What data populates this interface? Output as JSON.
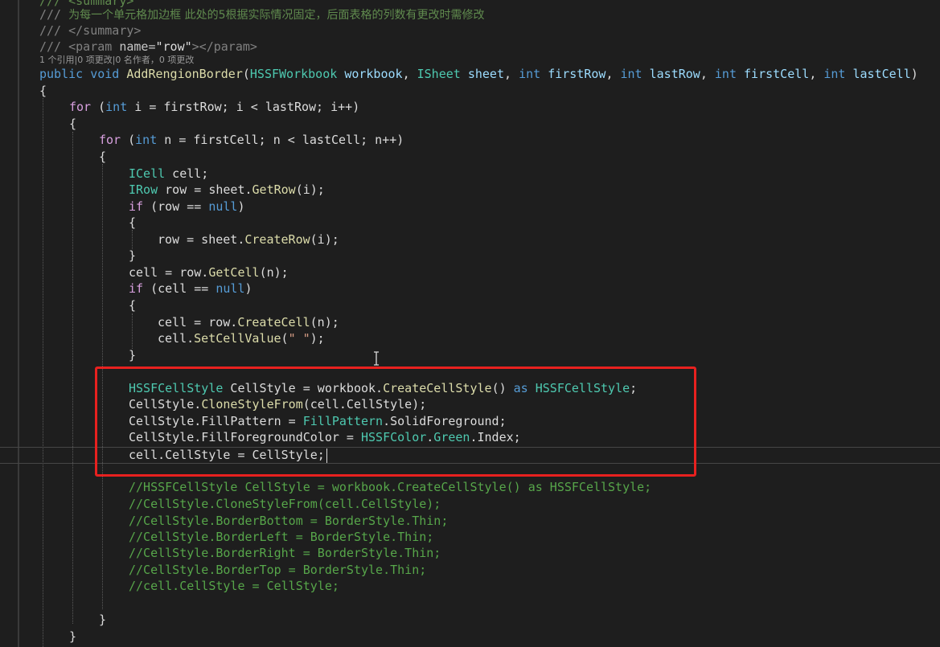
{
  "editor": {
    "theme": "dark",
    "accent_colors": {
      "comment": "#57a64a",
      "keyword": "#569cd6",
      "control": "#d8a0df",
      "type": "#4ec9b0",
      "method": "#dcdcaa",
      "highlight_box": "#e8211f"
    }
  },
  "code": {
    "l0": "/// <summary>",
    "l1_prefix": "/// ",
    "l1_text": "为每一个单元格加边框 此处的5根据实际情况固定，后面表格的列数有更改时需修改",
    "l2_prefix": "/// ",
    "l2_tag": "</summary>",
    "l3_prefix": "/// ",
    "l3_tag_open": "<param ",
    "l3_attr": "name=",
    "l3_val": "\"row\"",
    "l3_tag_close": "></param>",
    "codelens": "1 个引用|0 项更改|0 名作者，0 项更改",
    "sig": {
      "public": "public",
      "void": "void",
      "name": "AddRengionBorder",
      "p1type": "HSSFWorkbook",
      "p1": "workbook",
      "p2type": "ISheet",
      "p2": "sheet",
      "int1": "int",
      "p3": "firstRow",
      "int2": "int",
      "p4": "lastRow",
      "int3": "int",
      "p5": "firstCell",
      "int4": "int",
      "p6": "lastCell"
    },
    "open_brace": "{",
    "close_brace": "}",
    "for1_kw": "for",
    "for1_rest_a": " (",
    "for1_int": "int",
    "for1_rest_b": " i = firstRow; i < lastRow; i++)",
    "for2_kw": "for",
    "for2_rest_a": " (",
    "for2_int": "int",
    "for2_rest_b": " n = firstCell; n < lastCell; n++)",
    "icell_type": "ICell",
    "icell_rest": " cell;",
    "irow_type": "IRow",
    "irow_rest_a": " row = sheet.",
    "irow_method": "GetRow",
    "irow_rest_b": "(i);",
    "if1_kw": "if",
    "if1_rest_a": " (row == ",
    "if1_null": "null",
    "if1_rest_b": ")",
    "createrow_a": "row = sheet.",
    "createrow_method": "CreateRow",
    "createrow_b": "(i);",
    "getcell_a": "cell = row.",
    "getcell_method": "GetCell",
    "getcell_b": "(n);",
    "if2_kw": "if",
    "if2_rest_a": " (cell == ",
    "if2_null": "null",
    "if2_rest_b": ")",
    "createcell_a": "cell = row.",
    "createcell_method": "CreateCell",
    "createcell_b": "(n);",
    "setvalue_a": "cell.",
    "setvalue_method": "SetCellValue",
    "setvalue_b": "(",
    "setvalue_str": "\" \"",
    "setvalue_c": ");",
    "h1_type": "HSSFCellStyle",
    "h1_rest_a": " CellStyle = workbook.",
    "h1_method": "CreateCellStyle",
    "h1_rest_b": "() ",
    "h1_as": "as",
    "h1_rest_c": " ",
    "h1_type2": "HSSFCellStyle",
    "h1_semi": ";",
    "h2_a": "CellStyle.",
    "h2_method": "CloneStyleFrom",
    "h2_b": "(cell.CellStyle);",
    "h3_a": "CellStyle.FillPattern = ",
    "h3_type": "FillPattern",
    "h3_b": ".SolidForeground;",
    "h4_a": "CellStyle.FillForegroundColor = ",
    "h4_type": "HSSFColor",
    "h4_dot": ".",
    "h4_type2": "Green",
    "h4_b": ".Index;",
    "h5": "cell.CellStyle = CellStyle;",
    "c1": "//HSSFCellStyle CellStyle = workbook.CreateCellStyle() as HSSFCellStyle;",
    "c2": "//CellStyle.CloneStyleFrom(cell.CellStyle);",
    "c3": "//CellStyle.BorderBottom = BorderStyle.Thin;",
    "c4": "//CellStyle.BorderLeft = BorderStyle.Thin;",
    "c5": "//CellStyle.BorderRight = BorderStyle.Thin;",
    "c6": "//CellStyle.BorderTop = BorderStyle.Thin;",
    "c7": "//cell.CellStyle = CellStyle;"
  }
}
